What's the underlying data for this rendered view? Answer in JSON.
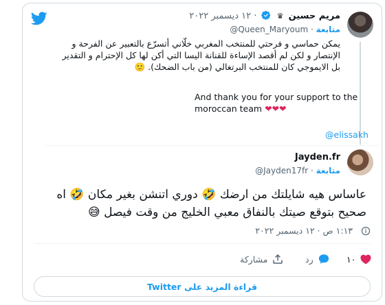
{
  "quoted": {
    "name": "مريم حسين",
    "crown": "♛",
    "date": "١٢ ديسمبر ٢٠٢٢",
    "follow": "متابعة",
    "handle": "@Queen_Maryoum",
    "text": "يمكن حماسي و فرحتي للمنتخب المغربي خلّاني أتسرّع بالتعبير عن الفرحة و الإنتصار و لكن لم أقصد الإساءة للقنانة اليسا التي أكن لها كل الإحترام و التقدير بل الايموجي كان للمنتخب البرتغالي (من باب الضحك). 🙂",
    "text_en": "And thank you for your support to the moroccan team",
    "hearts": "❤❤❤",
    "mention": "@elissakh"
  },
  "reply": {
    "name": "Jayden.fr",
    "follow": "متابعة",
    "handle": "@Jayden17fr",
    "text": "عاساس هيه شايلتك من ارضك 🤣 دوري اتنشن بغير مكان 🤣 اه صحيح بتوقع صيتك بالنفاق معبي الخليج من وقت فيصل 😅",
    "time": "١:١٣ ص · ١٢ ديسمبر ٢٠٢٢"
  },
  "actions": {
    "likes": "١٠",
    "reply_label": "رد",
    "share_label": "مشاركة"
  },
  "more_button": "قراءة المزيد على Twitter",
  "colors": {
    "accent": "#1d9bf0",
    "like": "#e0245e",
    "muted": "#536471",
    "border": "#cfd9de"
  },
  "icons": [
    "twitter-logo-icon",
    "verified-icon",
    "crown-icon",
    "heart-icon",
    "comment-icon",
    "share-icon",
    "info-icon"
  ]
}
